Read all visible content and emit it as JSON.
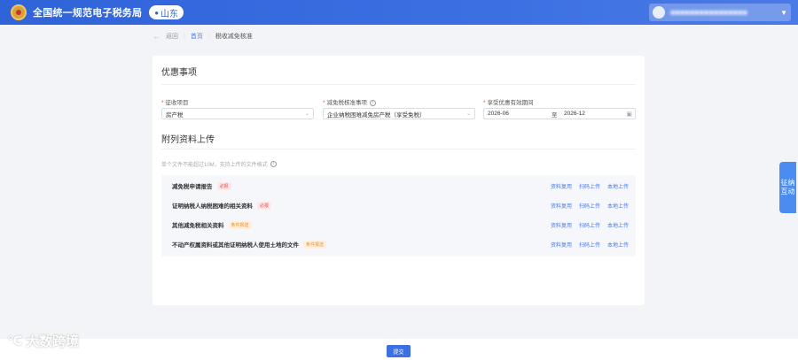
{
  "header": {
    "brand": "全国统一规范电子税务局",
    "region": "山东",
    "user_name": "■■■■■■■■■■■■■■■■"
  },
  "breadcrumb": {
    "back": "←",
    "back_label": "返回",
    "home": "首页",
    "current": "税收减免核准"
  },
  "section1": {
    "title": "优惠事项",
    "fields": {
      "tax_item_label": "征收项目",
      "tax_item_value": "房产税",
      "reduction_label": "减免税核准事项",
      "reduction_value": "企业纳税困难减免房产税（享受免税）",
      "period_label": "享受优惠有效期间",
      "period_start": "2026-06",
      "period_to": "至",
      "period_end": "2026-12"
    }
  },
  "section2": {
    "title": "附列资料上传",
    "hint": "单个文件不能超过10M，支持上传的文件格式",
    "files": [
      {
        "name": "减免税申请报告",
        "tag": "必报"
      },
      {
        "name": "证明纳税人纳税困难的相关资料",
        "tag": "必报"
      },
      {
        "name": "其他减免税相关资料",
        "tag": "条件报送"
      },
      {
        "name": "不动产权属资料或其他证明纳税人使用土地的文件",
        "tag": "条件报送"
      }
    ],
    "actions": {
      "reuse": "资料复用",
      "scan": "扫码上传",
      "local": "本地上传"
    }
  },
  "side_button": {
    "line1": "征纳",
    "line2": "互动"
  },
  "footer": {
    "submit": "提交"
  },
  "watermark": {
    "text": "大数跨境"
  }
}
